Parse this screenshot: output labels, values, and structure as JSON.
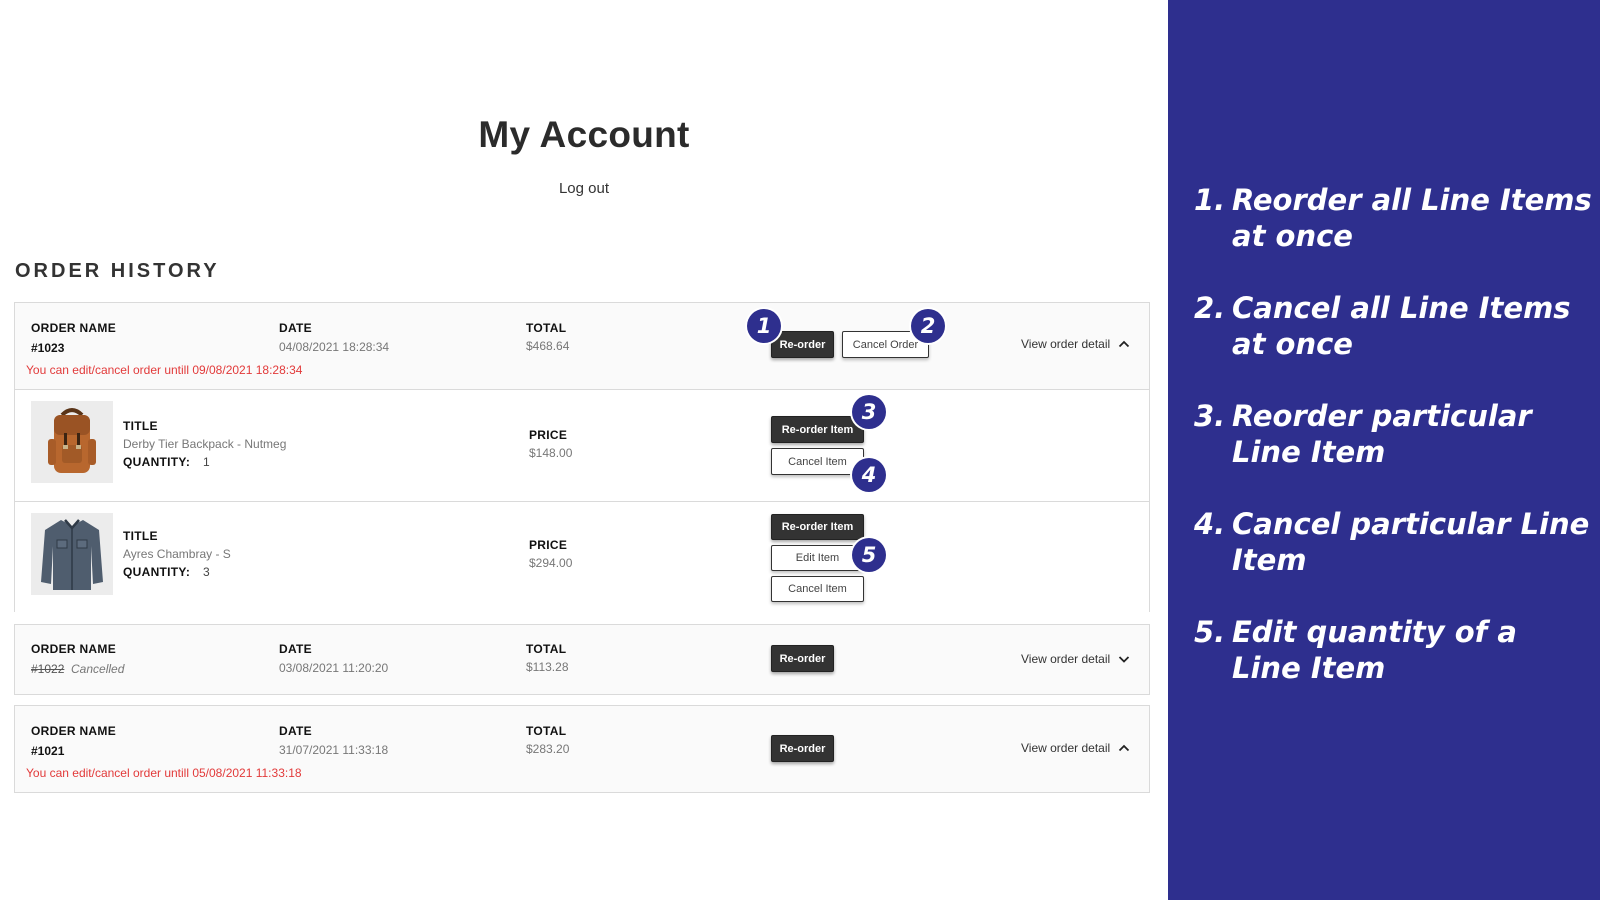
{
  "account": {
    "title": "My Account",
    "logout": "Log out",
    "section_title": "ORDER HISTORY"
  },
  "labels": {
    "order_name": "ORDER NAME",
    "date": "DATE",
    "total": "TOTAL",
    "title": "TITLE",
    "quantity": "QUANTITY:",
    "price": "PRICE",
    "reorder": "Re-order",
    "cancel_order": "Cancel Order",
    "reorder_item": "Re-order Item",
    "cancel_item": "Cancel Item",
    "edit_item": "Edit Item",
    "view_detail": "View order detail"
  },
  "orders": [
    {
      "name": "#1023",
      "date": "04/08/2021 18:28:34",
      "total": "$468.64",
      "notice": "You can edit/cancel order untill 09/08/2021 18:28:34",
      "expanded": true,
      "items": [
        {
          "title": "Derby Tier Backpack - Nutmeg",
          "quantity": "1",
          "price": "$148.00",
          "image": "backpack-image"
        },
        {
          "title": "Ayres Chambray - S",
          "quantity": "3",
          "price": "$294.00",
          "image": "shirt-image"
        }
      ]
    },
    {
      "name": "#1022",
      "status": "Cancelled",
      "date": "03/08/2021 11:20:20",
      "total": "$113.28",
      "expanded": false
    },
    {
      "name": "#1021",
      "date": "31/07/2021 11:33:18",
      "total": "$283.20",
      "notice": "You can edit/cancel order untill 05/08/2021 11:33:18",
      "expanded": true
    }
  ],
  "callouts": [
    "1",
    "2",
    "3",
    "4",
    "5"
  ],
  "features": [
    {
      "num": "1.",
      "text": "Reorder all Line Items at once"
    },
    {
      "num": "2.",
      "text": "Cancel all Line Items at once"
    },
    {
      "num": "3.",
      "text": "Reorder particular Line Item"
    },
    {
      "num": "4.",
      "text": "Cancel particular Line Item"
    },
    {
      "num": "5.",
      "text": "Edit quantity of a Line Item"
    }
  ],
  "colors": {
    "panel_bg": "#2e2f8e",
    "badge_bg": "#2e2f8e",
    "notice_text": "#e23a3a",
    "dark_button": "#333333"
  }
}
